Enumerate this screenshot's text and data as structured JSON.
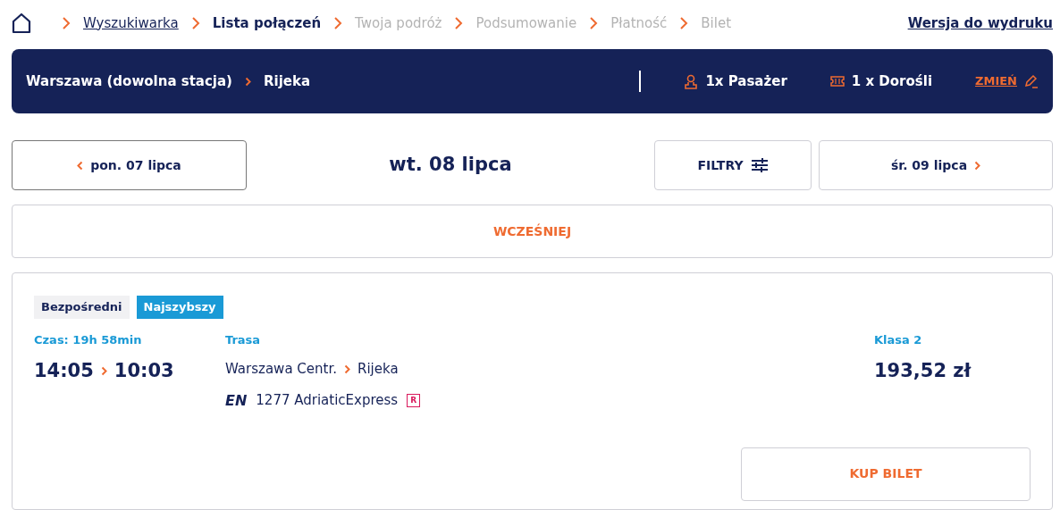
{
  "breadcrumb": [
    {
      "label": "Wyszukiwarka",
      "selected": false,
      "disabled": false
    },
    {
      "label": "Lista połączeń",
      "selected": true,
      "disabled": false
    },
    {
      "label": "Twoja podróż",
      "selected": false,
      "disabled": true
    },
    {
      "label": "Podsumowanie",
      "selected": false,
      "disabled": true
    },
    {
      "label": "Płatność",
      "selected": false,
      "disabled": true
    },
    {
      "label": "Bilet",
      "selected": false,
      "disabled": true
    }
  ],
  "print_link": "Wersja do wydruku",
  "route_bar": {
    "from": "Warszawa (dowolna stacja)",
    "to": "Rijeka",
    "passengers": "1x Pasażer",
    "tickets": "1 x Dorośli",
    "change": "ZMIEŃ"
  },
  "date_nav": {
    "previous": "pon. 07 lipca",
    "current": "wt. 08 lipca",
    "filters": "FILTRY",
    "next": "śr. 09 lipca"
  },
  "earlier": "WCZEŚNIEJ",
  "connection": {
    "tags": [
      {
        "label": "Bezpośredni",
        "kind": "plain"
      },
      {
        "label": "Najszybszy",
        "kind": "highlight"
      }
    ],
    "duration": "Czas: 19h 58min",
    "departure": "14:05",
    "arrival": "10:03",
    "route_label": "Trasa",
    "route_from": "Warszawa Centr.",
    "route_to": "Rijeka",
    "train_category": "EN",
    "train": "1277 AdriaticExpress",
    "reservation_mark": "R",
    "class": "Klasa 2",
    "price": "193,52 zł",
    "buy": "KUP BILET"
  }
}
